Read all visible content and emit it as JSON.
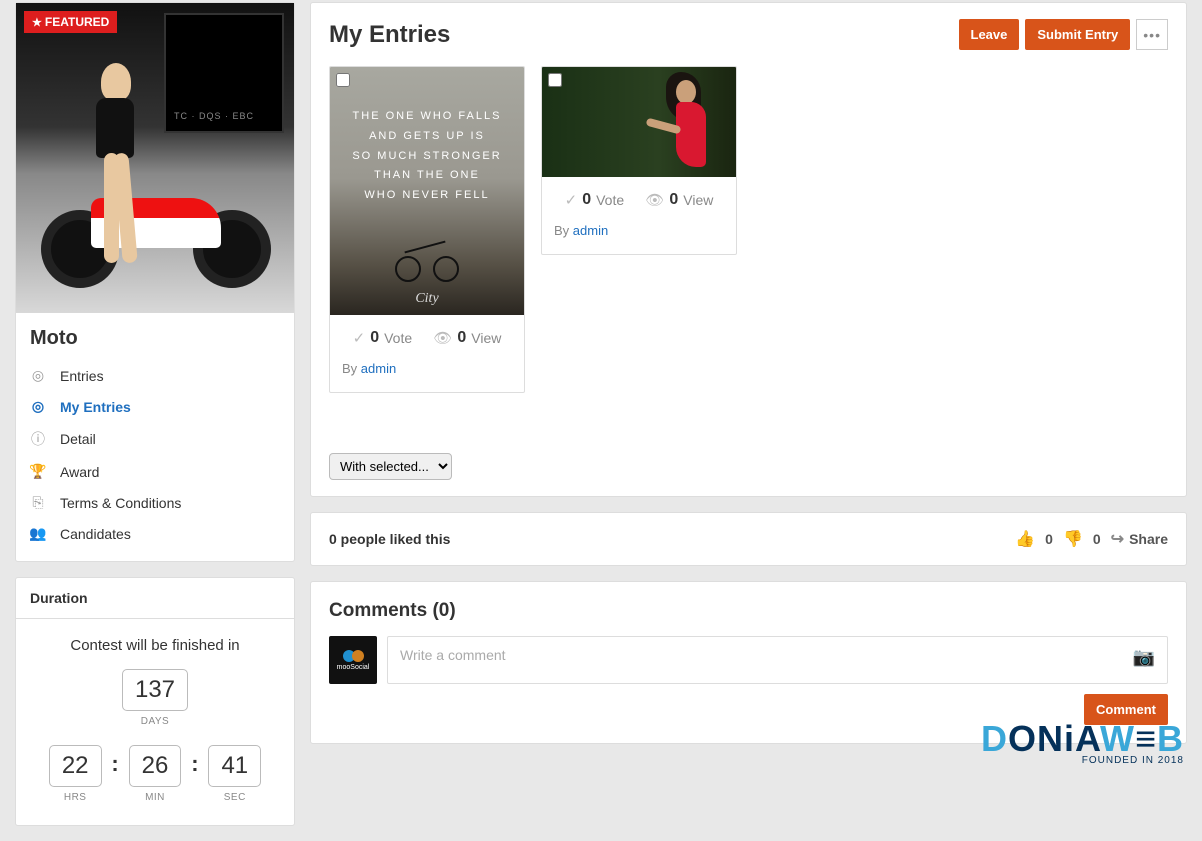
{
  "sidebar": {
    "featured_badge": "FEATURED",
    "title": "Moto",
    "nav": [
      {
        "label": "Entries",
        "active": false
      },
      {
        "label": "My Entries",
        "active": true
      },
      {
        "label": "Detail",
        "active": false
      },
      {
        "label": "Award",
        "active": false
      },
      {
        "label": "Terms & Conditions",
        "active": false
      },
      {
        "label": "Candidates",
        "active": false
      }
    ]
  },
  "duration": {
    "header": "Duration",
    "message": "Contest will be finished in",
    "days": "137",
    "days_label": "DAYS",
    "hrs": "22",
    "hrs_label": "HRS",
    "min": "26",
    "min_label": "MIN",
    "sec": "41",
    "sec_label": "SEC"
  },
  "entries": {
    "title": "My Entries",
    "leave_btn": "Leave",
    "submit_btn": "Submit Entry",
    "more_btn": "•••",
    "quote_line1": "THE ONE WHO FALLS",
    "quote_line2": "AND GETS UP IS",
    "quote_line3": "SO MUCH STRONGER",
    "quote_line4": "THAN THE ONE",
    "quote_line5": "WHO NEVER FELL",
    "cards": [
      {
        "votes": "0",
        "vote_label": "Vote",
        "views": "0",
        "view_label": "View",
        "by": "By ",
        "author": "admin"
      },
      {
        "votes": "0",
        "vote_label": "Vote",
        "views": "0",
        "view_label": "View",
        "by": "By ",
        "author": "admin"
      }
    ],
    "select_label": "With selected..."
  },
  "likes": {
    "text": "0 people liked this",
    "up": "0",
    "down": "0",
    "share": "Share"
  },
  "comments": {
    "title": "Comments (0)",
    "placeholder": "Write a comment",
    "button": "Comment",
    "avatar_text": "mooSocial"
  },
  "watermark": {
    "d": "D",
    "onia": "ONiA",
    "w": "W",
    "b": "B",
    "sub": "FOUNDED IN 2018"
  }
}
